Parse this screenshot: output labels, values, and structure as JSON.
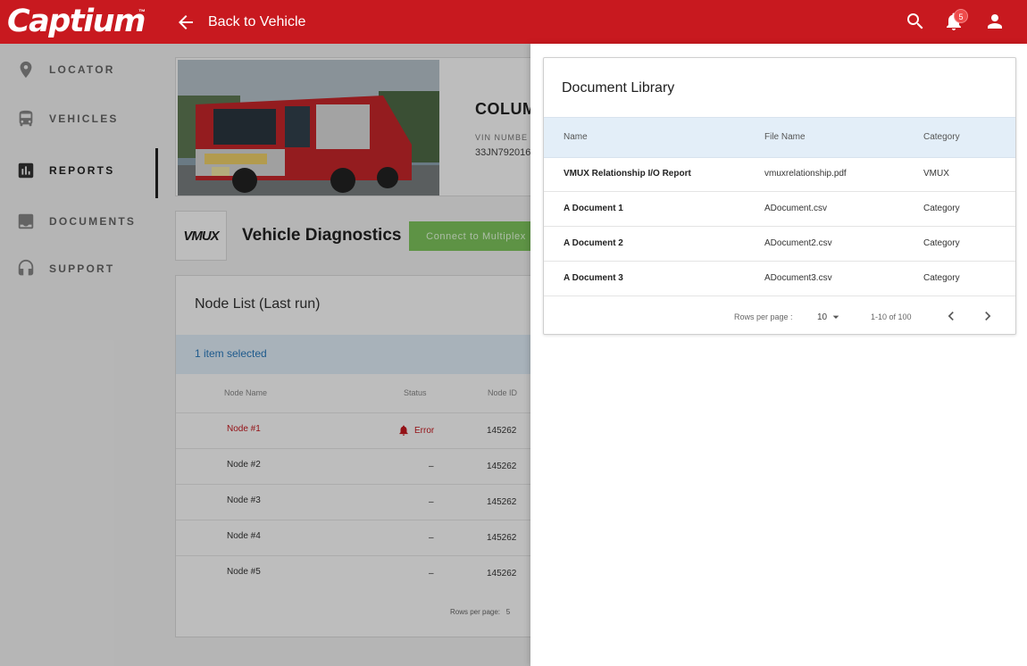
{
  "header": {
    "logo": "Captium",
    "logo_tm": "™",
    "back_label": "Back to Vehicle",
    "notification_count": "5",
    "colors": {
      "brand": "#c8191f",
      "badge": "#ef4b4b"
    }
  },
  "sidebar": {
    "items": [
      {
        "label": "LOCATOR",
        "icon": "location-pin-icon"
      },
      {
        "label": "VEHICLES",
        "icon": "bus-icon"
      },
      {
        "label": "REPORTS",
        "icon": "bar-chart-icon",
        "active": true
      },
      {
        "label": "DOCUMENTS",
        "icon": "download-box-icon"
      },
      {
        "label": "SUPPORT",
        "icon": "headset-icon"
      }
    ]
  },
  "vehicle": {
    "title": "COLUM",
    "vin_label": "VIN NUMBE",
    "vin_value": "33JN792016"
  },
  "diagnostics": {
    "logo_text": "VMUX",
    "title": "Vehicle Diagnostics",
    "connect_label": "Connect to Multiplex"
  },
  "node_list": {
    "title": "Node List (Last run)",
    "selected_text": "1 item selected",
    "headers": {
      "name": "Node Name",
      "status": "Status",
      "id": "Node ID"
    },
    "rows": [
      {
        "name": "Node #1",
        "status": "Error",
        "id": "145262"
      },
      {
        "name": "Node #2",
        "status": "–",
        "id": "145262"
      },
      {
        "name": "Node #3",
        "status": "–",
        "id": "145262"
      },
      {
        "name": "Node #4",
        "status": "–",
        "id": "145262"
      },
      {
        "name": "Node #5",
        "status": "–",
        "id": "145262"
      }
    ],
    "footer": "Rows per page:   5"
  },
  "document_library": {
    "title": "Document Library",
    "headers": {
      "name": "Name",
      "file_name": "File Name",
      "category": "Category"
    },
    "rows": [
      {
        "name": "VMUX Relationship I/O Report",
        "file_name": "vmuxrelationship.pdf",
        "category": "VMUX"
      },
      {
        "name": "A Document 1",
        "file_name": "ADocument.csv",
        "category": "Category"
      },
      {
        "name": "A Document 2",
        "file_name": "ADocument2.csv",
        "category": "Category"
      },
      {
        "name": "A Document 3",
        "file_name": "ADocument3.csv",
        "category": "Category"
      }
    ],
    "footer": {
      "rows_per_page_label": "Rows per page :",
      "rows_per_page_value": "10",
      "range": "1-10 of 100"
    }
  }
}
